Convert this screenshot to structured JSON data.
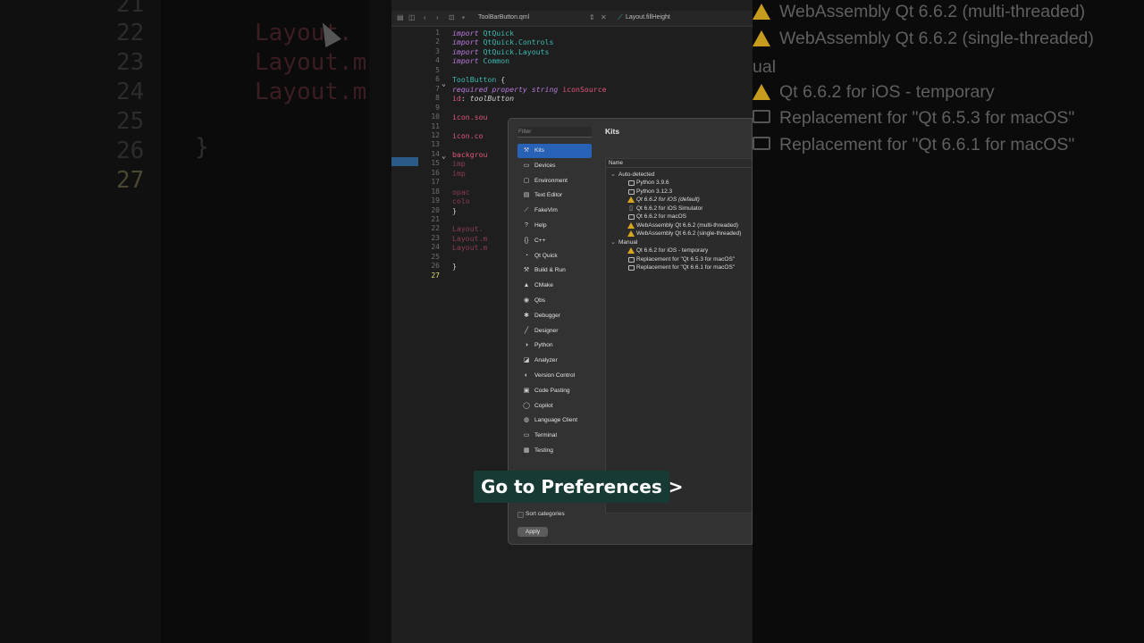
{
  "left_zoom": {
    "line_numbers": [
      "21",
      "22",
      "23",
      "24",
      "25",
      "26",
      "27"
    ],
    "code_lines": [
      "Layout.",
      "Layout.m",
      "Layout.m"
    ],
    "brace": "}"
  },
  "editor": {
    "tab_file": "ToolBarButton.qml",
    "tab_symbol": "Layout.fillHeight",
    "lines": [
      {
        "n": "1",
        "parts": [
          [
            "kw",
            "import"
          ],
          [
            "ty",
            " QtQuick"
          ]
        ]
      },
      {
        "n": "2",
        "parts": [
          [
            "kw",
            "import"
          ],
          [
            "ty",
            " QtQuick.Controls"
          ]
        ]
      },
      {
        "n": "3",
        "parts": [
          [
            "kw",
            "import"
          ],
          [
            "ty",
            " QtQuick.Layouts"
          ]
        ]
      },
      {
        "n": "4",
        "parts": [
          [
            "kw",
            "import"
          ],
          [
            "ty",
            " Common"
          ]
        ]
      },
      {
        "n": "5",
        "parts": []
      },
      {
        "n": "6",
        "parts": [
          [
            "ty",
            "ToolButton"
          ],
          [
            "plain",
            " {"
          ]
        ]
      },
      {
        "n": "7",
        "parts": [
          [
            "kw",
            "    required property"
          ],
          [
            "kw",
            " string"
          ],
          [
            "pr",
            " iconSource"
          ]
        ]
      },
      {
        "n": "8",
        "parts": [
          [
            "pr",
            "    id"
          ],
          [
            "plain",
            ": "
          ],
          [
            "idv",
            "toolButton"
          ]
        ]
      },
      {
        "n": "9",
        "parts": []
      },
      {
        "n": "10",
        "parts": [
          [
            "pr",
            "    icon.sou"
          ]
        ]
      },
      {
        "n": "11",
        "parts": []
      },
      {
        "n": "12",
        "parts": [
          [
            "pr",
            "    icon.co"
          ]
        ]
      },
      {
        "n": "13",
        "parts": []
      },
      {
        "n": "14",
        "parts": [
          [
            "pr",
            "    backgrou"
          ]
        ]
      },
      {
        "n": "15",
        "parts": [
          [
            "dim",
            "        imp"
          ]
        ]
      },
      {
        "n": "16",
        "parts": [
          [
            "dim",
            "        imp"
          ]
        ]
      },
      {
        "n": "17",
        "parts": []
      },
      {
        "n": "18",
        "parts": [
          [
            "dim",
            "        opac"
          ]
        ]
      },
      {
        "n": "19",
        "parts": [
          [
            "dim",
            "        colo"
          ]
        ]
      },
      {
        "n": "20",
        "parts": [
          [
            "plain",
            "    }"
          ]
        ]
      },
      {
        "n": "21",
        "parts": []
      },
      {
        "n": "22",
        "parts": [
          [
            "dim",
            "    Layout."
          ]
        ]
      },
      {
        "n": "23",
        "parts": [
          [
            "dim",
            "    Layout.m"
          ]
        ]
      },
      {
        "n": "24",
        "parts": [
          [
            "dim",
            "    Layout.m"
          ]
        ]
      },
      {
        "n": "25",
        "parts": []
      },
      {
        "n": "26",
        "parts": [
          [
            "plain",
            "}"
          ]
        ]
      },
      {
        "n": "27",
        "parts": []
      }
    ]
  },
  "right_zoom": {
    "rows": [
      {
        "icon": "warning",
        "text": "WebAssembly Qt 6.6.2 (multi-threaded)"
      },
      {
        "icon": "warning",
        "text": "WebAssembly Qt 6.6.2 (single-threaded)"
      },
      {
        "icon": "warning",
        "text": "Qt 6.6.2 for iOS - temporary"
      },
      {
        "icon": "monitor",
        "text": "Replacement for \"Qt 6.5.3 for macOS\""
      },
      {
        "icon": "monitor",
        "text": "Replacement for \"Qt 6.6.1 for macOS\""
      }
    ],
    "manual_label": "ual"
  },
  "dialog": {
    "filter_placeholder": "Filter",
    "page_title": "Kits",
    "nav": [
      {
        "label": "Kits",
        "icon": "⚒",
        "selected": true
      },
      {
        "label": "Devices",
        "icon": "▭"
      },
      {
        "label": "Environment",
        "icon": "▢"
      },
      {
        "label": "Text Editor",
        "icon": "▤"
      },
      {
        "label": "FakeVim",
        "icon": "⟋"
      },
      {
        "label": "Help",
        "icon": "?"
      },
      {
        "label": "C++",
        "icon": "{}"
      },
      {
        "label": "Qt Quick",
        "icon": "◔"
      },
      {
        "label": "Build & Run",
        "icon": "⚒"
      },
      {
        "label": "CMake",
        "icon": "▲"
      },
      {
        "label": "Qbs",
        "icon": "◉"
      },
      {
        "label": "Debugger",
        "icon": "✱"
      },
      {
        "label": "Designer",
        "icon": "╱"
      },
      {
        "label": "Python",
        "icon": "◑"
      },
      {
        "label": "Analyzer",
        "icon": "◪"
      },
      {
        "label": "Version Control",
        "icon": "◐"
      },
      {
        "label": "Code Pasting",
        "icon": "▣"
      },
      {
        "label": "Copilot",
        "icon": "◯"
      },
      {
        "label": "Language Client",
        "icon": "◍"
      },
      {
        "label": "Terminal",
        "icon": "▭"
      },
      {
        "label": "Testing",
        "icon": "▦"
      }
    ],
    "tree_header": "Name",
    "tree": [
      {
        "level": 0,
        "icon": "chevron",
        "text": "Auto-detected"
      },
      {
        "level": 1,
        "icon": "monitor",
        "text": "Python 3.9.6"
      },
      {
        "level": 1,
        "icon": "monitor",
        "text": "Python 3.12.3"
      },
      {
        "level": 1,
        "icon": "warning",
        "text": "Qt 6.6.2 for iOS (default)",
        "italic": true
      },
      {
        "level": 1,
        "icon": "device",
        "text": "Qt 6.6.2 for iOS Simulator"
      },
      {
        "level": 1,
        "icon": "monitor",
        "text": "Qt 6.6.2 for macOS"
      },
      {
        "level": 1,
        "icon": "warning",
        "text": "WebAssembly Qt 6.6.2 (multi-threaded)"
      },
      {
        "level": 1,
        "icon": "warning",
        "text": "WebAssembly Qt 6.6.2 (single-threaded)"
      },
      {
        "level": 0,
        "icon": "chevron",
        "text": "Manual"
      },
      {
        "level": 1,
        "icon": "warning",
        "text": "Qt 6.6.2 for iOS - temporary"
      },
      {
        "level": 1,
        "icon": "monitor",
        "text": "Replacement for \"Qt 6.5.3 for macOS\""
      },
      {
        "level": 1,
        "icon": "monitor",
        "text": "Replacement for \"Qt 6.6.1 for macOS\""
      }
    ],
    "sort_label": "Sort categories",
    "apply_label": "Apply"
  },
  "caption": "Go to Preferences >",
  "colors": {
    "accent": "#2762b6",
    "warning": "#d8a61e",
    "caption_bg": "#183a35"
  }
}
